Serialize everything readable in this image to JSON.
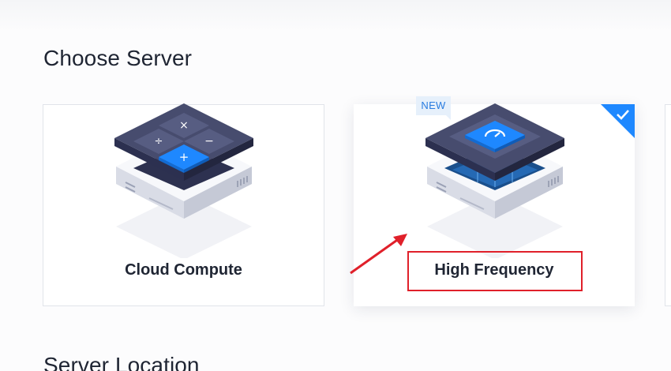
{
  "sections": {
    "choose_server_title": "Choose Server",
    "server_location_title": "Server Location"
  },
  "server_types": [
    {
      "label": "Cloud Compute",
      "selected": false,
      "badge": "",
      "icon": "cpu-calculator-icon"
    },
    {
      "label": "High Frequency",
      "selected": true,
      "badge": "NEW",
      "icon": "cpu-speedometer-icon"
    }
  ],
  "colors": {
    "accent": "#1e88ff",
    "annotation_red": "#e0202a",
    "chip_dark": "#3c4163",
    "badge_bg": "#e6f0fb"
  },
  "annotation": {
    "arrow": "red-arrow-pointing-to-high-frequency",
    "highlight": "red-box-around-high-frequency-label"
  }
}
